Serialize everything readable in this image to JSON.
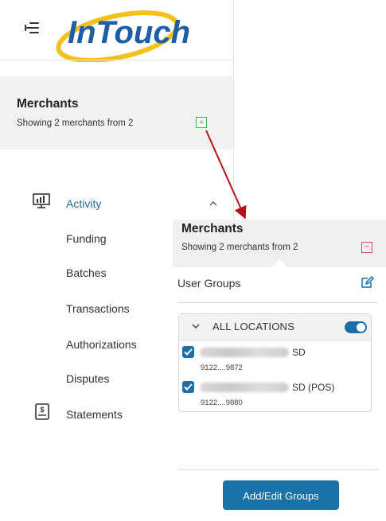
{
  "app": {
    "logo_text": "InTouch"
  },
  "merchants_panel": {
    "title": "Merchants",
    "subtitle": "Showing 2 merchants from 2",
    "expand_symbol": "+"
  },
  "nav": {
    "items": [
      {
        "label": "Activity",
        "icon": "monitor-chart-icon",
        "active": true
      },
      {
        "label": "Funding"
      },
      {
        "label": "Batches"
      },
      {
        "label": "Transactions"
      },
      {
        "label": "Authorizations"
      },
      {
        "label": "Disputes"
      },
      {
        "label": "Statements",
        "icon": "dollar-document-icon"
      }
    ]
  },
  "popup": {
    "title": "Merchants",
    "subtitle": "Showing 2 merchants from 2",
    "collapse_symbol": "−",
    "user_groups_label": "User Groups",
    "locations": {
      "header": "ALL LOCATIONS",
      "toggle_on": true,
      "items": [
        {
          "suffix": "SD",
          "id": "9122....9872",
          "checked": true
        },
        {
          "suffix": "SD (POS)",
          "id": "9122....9880",
          "checked": true
        }
      ]
    },
    "add_edit_button": "Add/Edit Groups"
  },
  "colors": {
    "accent_blue": "#1a73a8",
    "active_nav": "#1a6f9e",
    "plus_green": "#3bb54a",
    "minus_pink": "#e0407b",
    "arrow_red": "#b3121b",
    "logo_yellow": "#f2c21b"
  }
}
